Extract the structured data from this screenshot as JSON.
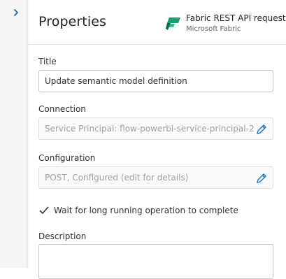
{
  "panel": {
    "title": "Properties",
    "connector": {
      "name": "Fabric REST API request",
      "provider": "Microsoft Fabric",
      "icon": "fabric-icon"
    }
  },
  "fields": {
    "title": {
      "label": "Title",
      "value": "Update semantic model definition"
    },
    "connection": {
      "label": "Connection",
      "value": "Service Principal: flow-powerbi-service-principal-2"
    },
    "configuration": {
      "label": "Configuration",
      "value": "POST, Configured (edit for details)"
    },
    "wait": {
      "label": "Wait for long running operation to complete",
      "checked": true
    },
    "description": {
      "label": "Description",
      "value": ""
    }
  },
  "colors": {
    "accent": "#0f6cbd",
    "fabric_dark": "#0b6a4d",
    "fabric_light": "#36c28a"
  }
}
